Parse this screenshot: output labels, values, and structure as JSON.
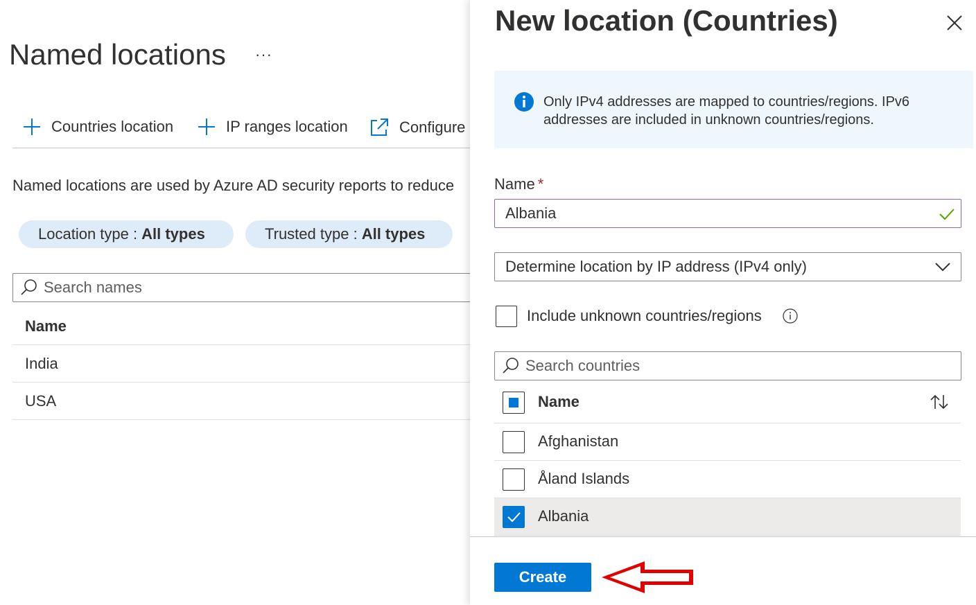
{
  "named_locations": {
    "title": "Named locations",
    "more": "···",
    "commands": [
      {
        "label": "Countries location"
      },
      {
        "label": "IP ranges location"
      },
      {
        "label": "Configure"
      }
    ],
    "description": "Named locations are used by Azure AD security reports to reduce",
    "filters": [
      {
        "label": "Location type :",
        "value": "All types"
      },
      {
        "label": "Trusted type :",
        "value": "All types"
      }
    ],
    "search": {
      "placeholder": "Search names"
    },
    "table": {
      "header": "Name",
      "rows": [
        "India",
        "USA"
      ]
    }
  },
  "panel": {
    "title": "New location (Countries)",
    "info": "Only IPv4 addresses are mapped to countries/regions. IPv6 addresses are included in unknown countries/regions.",
    "name_label": "Name",
    "required_mark": "*",
    "name_value": "Albania",
    "lookup_method": "Determine location by IP address (IPv4 only)",
    "include_unknown_label": "Include unknown countries/regions",
    "include_unknown_checked": false,
    "search": {
      "placeholder": "Search countries"
    },
    "countries_table": {
      "header": "Name",
      "rows": [
        {
          "name": "Afghanistan",
          "checked": false
        },
        {
          "name": "Åland Islands",
          "checked": false
        },
        {
          "name": "Albania",
          "checked": true
        }
      ]
    },
    "create_label": "Create"
  },
  "colors": {
    "accent": "#0078d4",
    "info_bg": "#eff6fc",
    "pill_bg": "#deecf9",
    "valid_check": "#57a300",
    "required": "#a4262c",
    "annotation_arrow": "#e00000"
  },
  "icons": [
    "plus-icon",
    "external-link-icon",
    "search-icon",
    "close-icon",
    "info-icon",
    "checkmark-icon",
    "chevron-down-icon",
    "sort-icon",
    "red-arrow-annotation"
  ]
}
